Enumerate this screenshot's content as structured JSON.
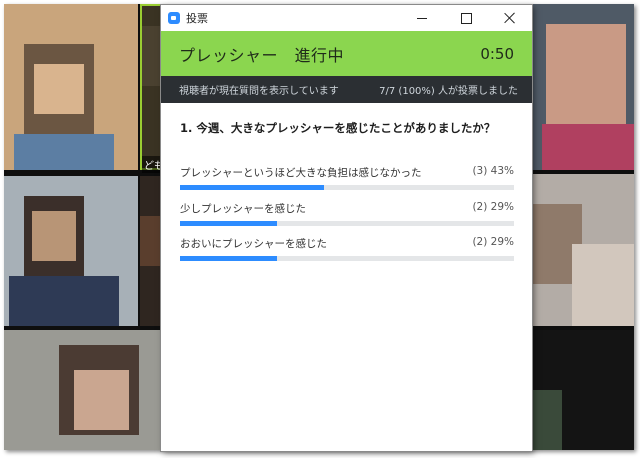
{
  "window": {
    "title": "投票",
    "icon": "zoom-app-icon",
    "controls": [
      "minimize-icon",
      "maximize-icon",
      "close-icon"
    ]
  },
  "header": {
    "title": "プレッシャー　進行中",
    "timer": "0:50",
    "color": "#8bd64f"
  },
  "status": {
    "left": "視聴者が現在質問を表示しています",
    "right": "7/7 (100%) 人が投票しました"
  },
  "question": "1. 今週、大きなプレッシャーを感じたことがありましたか？",
  "options": [
    {
      "label": "プレッシャーというほど大きな負担は感じなかった",
      "stat": "(3) 43%",
      "percent": 43
    },
    {
      "label": "少しプレッシャーを感じた",
      "stat": "(2) 29%",
      "percent": 29
    },
    {
      "label": "おおいにプレッシャーを感じた",
      "stat": "(2) 29%",
      "percent": 29
    }
  ],
  "gallery": {
    "name_label": "どもい"
  },
  "colors": {
    "accent": "#2d8cff",
    "status_bar": "#2b2f33"
  }
}
